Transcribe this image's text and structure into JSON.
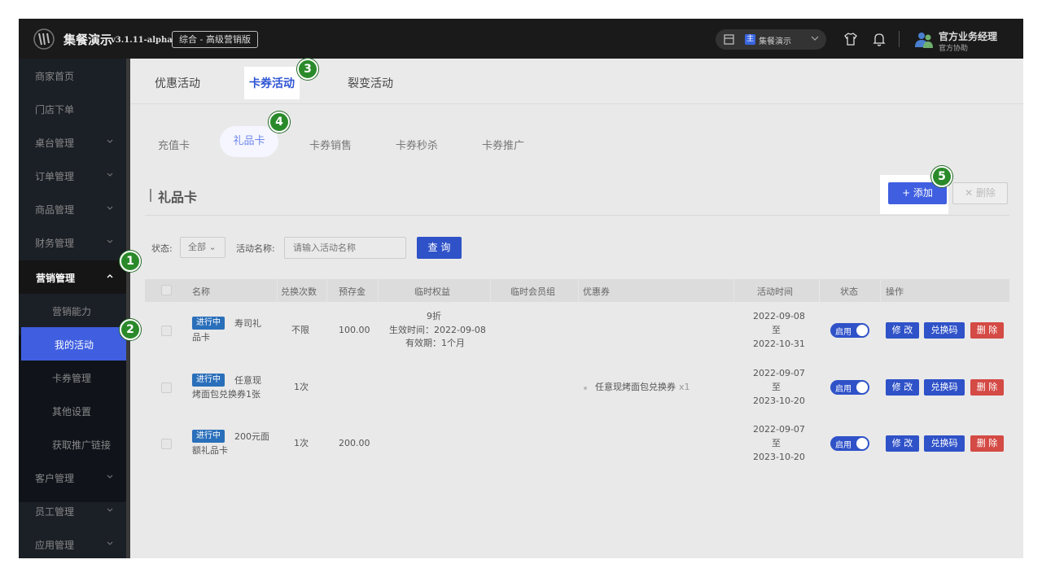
{
  "topbar": {
    "app_name": "集餐演示",
    "version": "v3.1.11-alpha",
    "edition": "综合 - 高级营销版",
    "store_badge": "主",
    "store_name": "集餐演示",
    "user_name": "官方业务经理",
    "user_sub": "官方协助"
  },
  "sidebar": {
    "items": [
      {
        "label": "商家首页"
      },
      {
        "label": "门店下单"
      },
      {
        "label": "桌台管理"
      },
      {
        "label": "订单管理"
      },
      {
        "label": "商品管理"
      },
      {
        "label": "财务管理"
      },
      {
        "label": "营销管理"
      },
      {
        "label": "营销能力"
      },
      {
        "label": "我的活动"
      },
      {
        "label": "卡券管理"
      },
      {
        "label": "其他设置"
      },
      {
        "label": "获取推广链接"
      },
      {
        "label": "客户管理"
      },
      {
        "label": "员工管理"
      },
      {
        "label": "应用管理"
      }
    ]
  },
  "tabs_top": [
    "优惠活动",
    "卡券活动",
    "裂变活动"
  ],
  "tabs_sub": [
    "充值卡",
    "礼品卡",
    "卡券销售",
    "卡券秒杀",
    "卡券推广"
  ],
  "section": {
    "title": "礼品卡",
    "add_label": "+ 添加",
    "delete_label": "✕ 删除"
  },
  "filter": {
    "status_label": "状态:",
    "status_value": "全部",
    "name_label": "活动名称:",
    "name_placeholder": "请输入活动名称",
    "query_label": "查 询"
  },
  "table": {
    "headers": [
      "名称",
      "兑换次数",
      "预存金",
      "临时权益",
      "临时会员组",
      "优惠券",
      "活动时间",
      "状态",
      "操作"
    ],
    "rows": [
      {
        "tag": "进行中",
        "name_line1": "寿司礼",
        "name_line2": "品卡",
        "times": "不限",
        "deposit": "100.00",
        "benefit_1": "9折",
        "benefit_2": "生效时间：2022-09-08",
        "benefit_3": "有效期：1个月",
        "coupon": "",
        "coupon_qty": "",
        "date_start": "2022-09-08",
        "date_to": "至",
        "date_end": "2022-10-31",
        "status": "启用"
      },
      {
        "tag": "进行中",
        "name_line1": "任意现",
        "name_line2": "烤面包兑换券1张",
        "times": "1次",
        "deposit": "",
        "benefit_1": "",
        "benefit_2": "",
        "benefit_3": "",
        "coupon": "任意现烤面包兑换券",
        "coupon_qty": "x1",
        "date_start": "2022-09-07",
        "date_to": "至",
        "date_end": "2023-10-20",
        "status": "启用"
      },
      {
        "tag": "进行中",
        "name_line1": "200元面",
        "name_line2": "额礼品卡",
        "times": "1次",
        "deposit": "200.00",
        "benefit_1": "",
        "benefit_2": "",
        "benefit_3": "",
        "coupon": "",
        "coupon_qty": "",
        "date_start": "2022-09-07",
        "date_to": "至",
        "date_end": "2023-10-20",
        "status": "启用"
      }
    ],
    "ops": {
      "edit": "修 改",
      "code": "兑换码",
      "del": "删 除"
    }
  },
  "steps": [
    "1",
    "2",
    "3",
    "4",
    "5"
  ],
  "colors": {
    "accent": "#3f5fe0",
    "danger": "#d44a45",
    "step": "#2a8a2a"
  }
}
